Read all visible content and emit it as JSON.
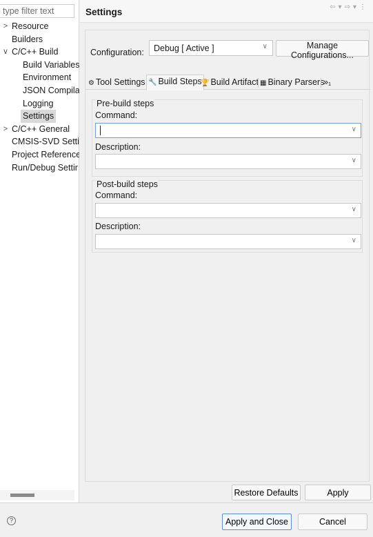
{
  "filter": {
    "placeholder": "type filter text"
  },
  "tree": {
    "items": [
      {
        "label": "Resource",
        "twisty": ">"
      },
      {
        "label": "Builders",
        "twisty": ""
      },
      {
        "label": "C/C++ Build",
        "twisty": "∨"
      },
      {
        "label": "Build Variables",
        "twisty": ""
      },
      {
        "label": "Environment",
        "twisty": ""
      },
      {
        "label": "JSON Compila",
        "twisty": ""
      },
      {
        "label": "Logging",
        "twisty": ""
      },
      {
        "label": "Settings",
        "twisty": ""
      },
      {
        "label": "C/C++ General",
        "twisty": ">"
      },
      {
        "label": "CMSIS-SVD Settir",
        "twisty": ""
      },
      {
        "label": "Project Reference:",
        "twisty": ""
      },
      {
        "label": "Run/Debug Settir",
        "twisty": ""
      }
    ]
  },
  "header": {
    "title": "Settings"
  },
  "config": {
    "label": "Configuration:",
    "selected": "Debug  [ Active ]",
    "manage_label": "Manage Configurations..."
  },
  "tabs": [
    {
      "label": "Tool Settings",
      "icon": "⚙"
    },
    {
      "label": "Build Steps",
      "icon": "🔧"
    },
    {
      "label": "Build Artifact",
      "icon": "🏆"
    },
    {
      "label": "Binary Parsers",
      "icon": "▦"
    },
    {
      "label": "»₁",
      "icon": ""
    }
  ],
  "pre_build": {
    "title": "Pre-build steps",
    "command_label": "Command:",
    "command_value": "",
    "description_label": "Description:",
    "description_value": ""
  },
  "post_build": {
    "title": "Post-build steps",
    "command_label": "Command:",
    "command_value": "",
    "description_label": "Description:",
    "description_value": ""
  },
  "buttons": {
    "restore_defaults": "Restore Defaults",
    "apply": "Apply",
    "apply_and_close": "Apply and Close",
    "cancel": "Cancel"
  },
  "help": {
    "symbol": "?"
  },
  "colors": {
    "accent": "#5a8fd0",
    "selection": "#d9d9d9"
  }
}
